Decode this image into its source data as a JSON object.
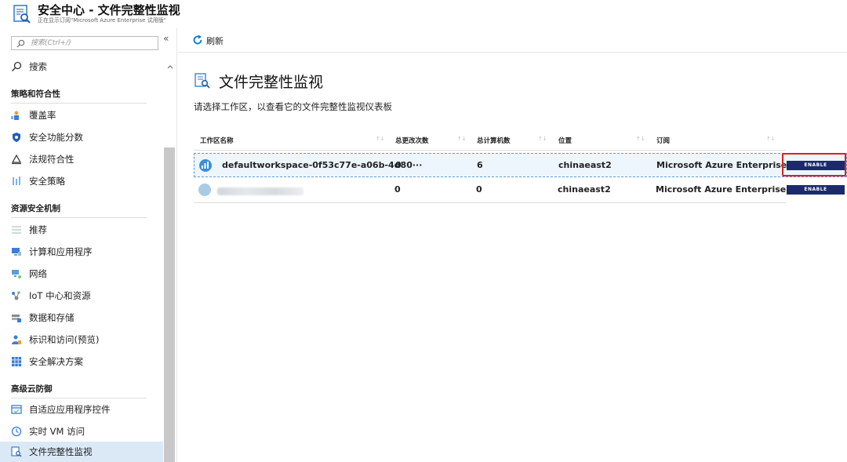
{
  "header": {
    "title": "安全中心 - 文件完整性监视",
    "subtitle": "正在显示订阅\"Microsoft Azure Enterprise 试用版\""
  },
  "sidebar": {
    "search_placeholder": "搜索(Ctrl+/)",
    "collapse_glyph": "«",
    "search_item": "搜索",
    "sections": [
      {
        "title": "策略和符合性",
        "items": [
          "覆盖率",
          "安全功能分数",
          "法规符合性",
          "安全策略"
        ]
      },
      {
        "title": "资源安全机制",
        "items": [
          "推荐",
          "计算和应用程序",
          "网络",
          "IoT 中心和资源",
          "数据和存储",
          "标识和访问(预览)",
          "安全解决方案"
        ]
      },
      {
        "title": "高级云防御",
        "items": [
          "自适应应用程序控件",
          "实时 VM 访问",
          "文件完整性监视"
        ]
      }
    ],
    "active_item": "文件完整性监视"
  },
  "toolbar": {
    "refresh_label": "刷新"
  },
  "page": {
    "title": "文件完整性监视",
    "description": "请选择工作区，以查看它的文件完整性监视仪表板"
  },
  "table": {
    "columns": [
      "工作区名称",
      "总更改次数",
      "总计算机数",
      "位置",
      "订阅"
    ],
    "rows": [
      {
        "workspace": "defaultworkspace-0f53c77e-a06b-4d80···",
        "changes": "0",
        "machines": "6",
        "location": "chinaeast2",
        "subscription": "Microsoft Azure Enterprise ...",
        "action": "ENABLE",
        "selected": true
      },
      {
        "workspace": "",
        "changes": "0",
        "machines": "0",
        "location": "chinaeast2",
        "subscription": "Microsoft Azure Enterprise ...",
        "action": "ENABLE",
        "selected": false
      }
    ]
  },
  "colors": {
    "accent": "#0078d4",
    "enable_button": "#1a2a6c",
    "highlight": "#e02020",
    "active_nav": "#dbe9f7"
  }
}
